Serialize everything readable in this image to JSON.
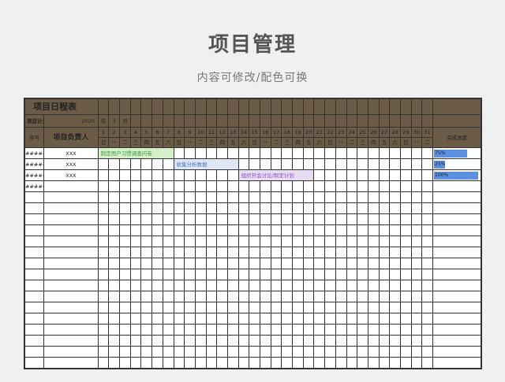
{
  "header": {
    "title": "项目管理",
    "subtitle": "内容可修改/配色可换"
  },
  "sheet": {
    "title": "项目日程表",
    "plan_time_label": "项目计划时间:",
    "year": "2020",
    "year_unit": "年",
    "month": "3",
    "month_unit": "月",
    "seq_label": "序号",
    "owner_label": "项目负责人",
    "progress_label": "完成进度",
    "days": [
      "1",
      "2",
      "3",
      "4",
      "5",
      "6",
      "7",
      "8",
      "9",
      "10",
      "11",
      "12",
      "13",
      "14",
      "15",
      "16",
      "17",
      "18",
      "19",
      "20",
      "21",
      "22",
      "23",
      "24",
      "25",
      "26",
      "27",
      "28",
      "29",
      "30",
      "31"
    ],
    "weekdays": [
      "日",
      "一",
      "二",
      "三",
      "四",
      "五",
      "六",
      "日",
      "一",
      "二",
      "三",
      "四",
      "五",
      "六",
      "日",
      "一",
      "二",
      "三",
      "四",
      "五",
      "六",
      "日",
      "一",
      "二",
      "三",
      "四",
      "五",
      "六",
      "日",
      "一",
      "二"
    ],
    "colors": {
      "header_bg": "#6b5b47",
      "progress_bar": "#5b8fe0"
    },
    "rows": [
      {
        "seq": "#####",
        "seq_blue": true,
        "owner": "XXX",
        "task": "制定用户习惯调查问卷",
        "start": 1,
        "end": 7,
        "task_bg": "#d5efc9",
        "task_color": "#3f9b3f",
        "progress": 75,
        "progress_text": "75%"
      },
      {
        "seq": "#####",
        "seq_blue": false,
        "owner": "XXX",
        "task": "收集分析数据",
        "start": 8,
        "end": 13,
        "task_bg": "#dce6f5",
        "task_color": "#4a76b8",
        "progress": 25,
        "progress_text": "25%"
      },
      {
        "seq": "#####",
        "seq_blue": true,
        "owner": "XXX",
        "task": "组织开会讨论/制定计划",
        "start": 14,
        "end": 20,
        "task_bg": "#e8dcf3",
        "task_color": "#8a4fc0",
        "progress": 100,
        "progress_text": "100%"
      },
      {
        "seq": "#####",
        "seq_blue": false,
        "owner": "",
        "task": "",
        "start": 0,
        "end": 0,
        "progress": null,
        "progress_text": ""
      }
    ],
    "empty_rows": 16
  }
}
